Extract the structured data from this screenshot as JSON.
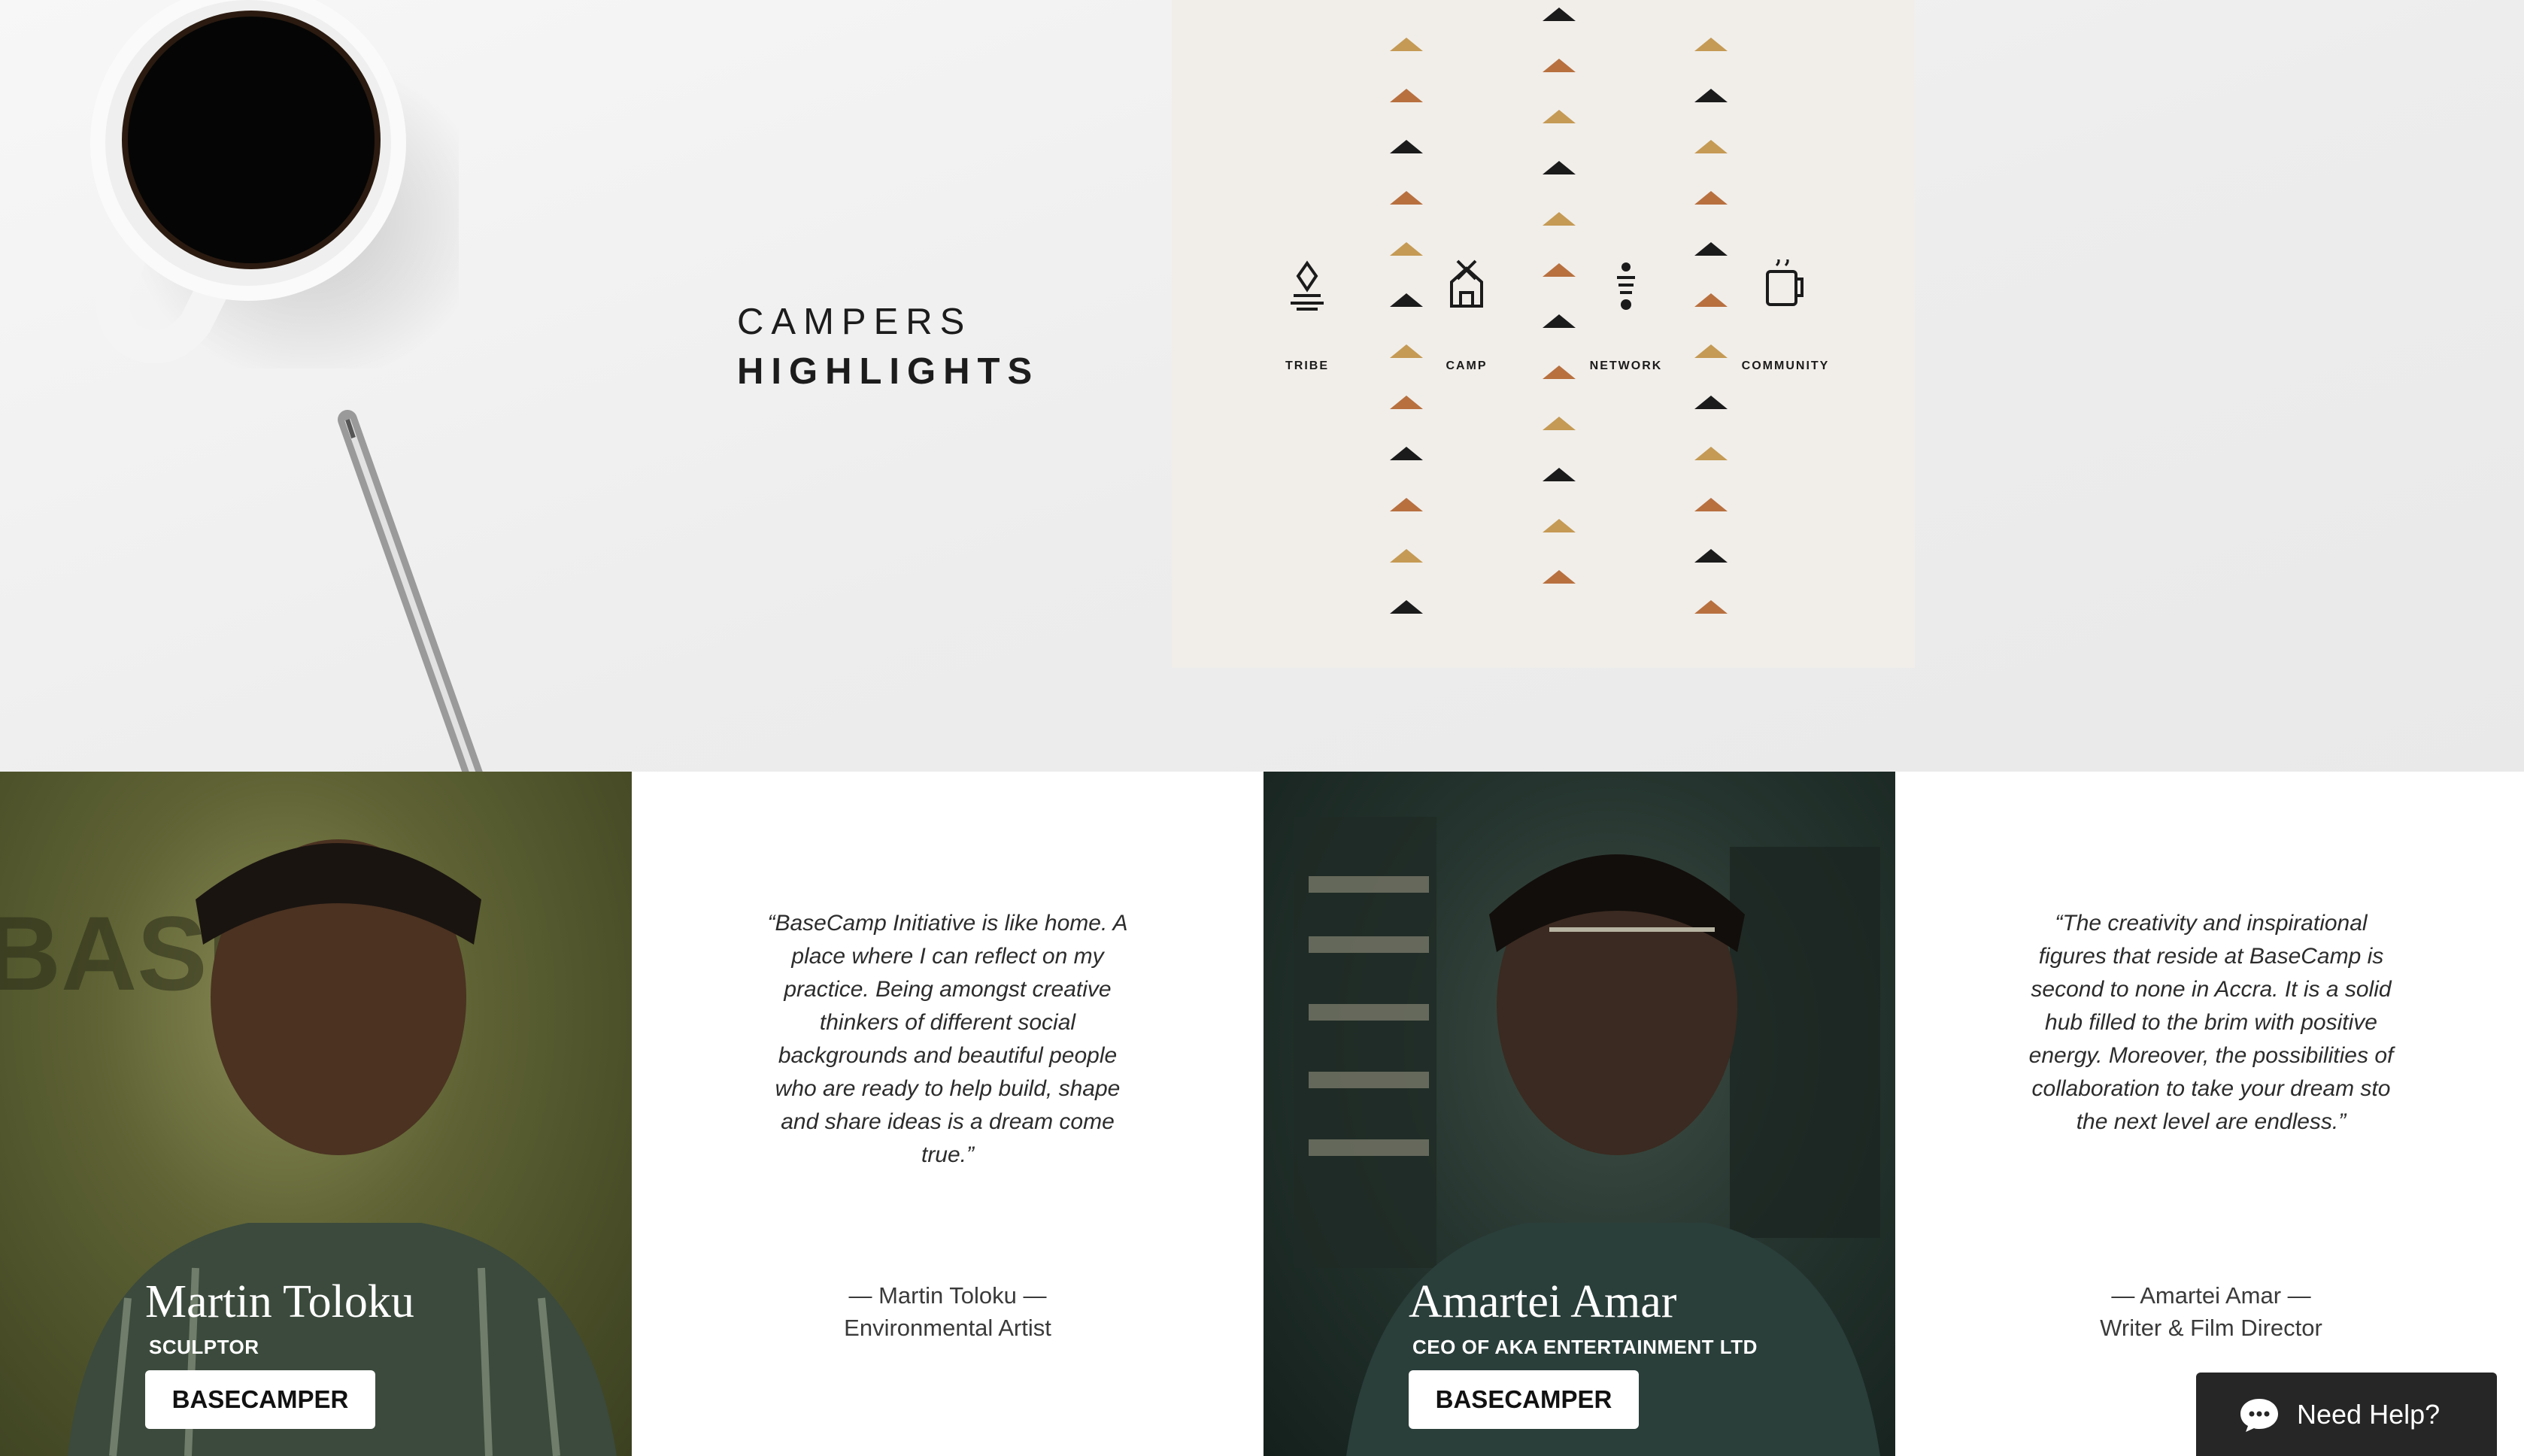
{
  "hero": {
    "title_line1": "CAMPERS",
    "title_line2": "HIGHLIGHTS"
  },
  "pillars": [
    {
      "label": "TRIBE",
      "icon": "flame-icon"
    },
    {
      "label": "CAMP",
      "icon": "tent-icon"
    },
    {
      "label": "NETWORK",
      "icon": "network-icon"
    },
    {
      "label": "COMMUNITY",
      "icon": "mug-icon"
    }
  ],
  "pattern_colors": {
    "tan": "#c59a54",
    "rust": "#b8703f",
    "black": "#1b1b1b"
  },
  "campers": [
    {
      "name": "Martin Toloku",
      "role": "SCULPTOR",
      "button": "BASECAMPER",
      "quote": "“BaseCamp Initiative is like home. A place where I can reflect on my practice. Being amongst creative thinkers of different social backgrounds and beautiful people who are ready to help build, shape and share ideas is a dream come true.”",
      "sig_name": "— Martin Toloku —",
      "sig_title": "Environmental Artist"
    },
    {
      "name": "Amartei Amar",
      "role": "CEO OF AKA ENTERTAINMENT LTD",
      "button": "BASECAMPER",
      "quote": "“The creativity and inspirational figures that reside at BaseCamp is second to none in Accra. It is a solid hub filled to the brim with positive energy. Moreover, the possibilities of collaboration to take your dream sto the next level are endless.”",
      "sig_name": "— Amartei Amar —",
      "sig_title": "Writer & Film Director"
    }
  ],
  "chat": {
    "label": "Need Help?"
  }
}
